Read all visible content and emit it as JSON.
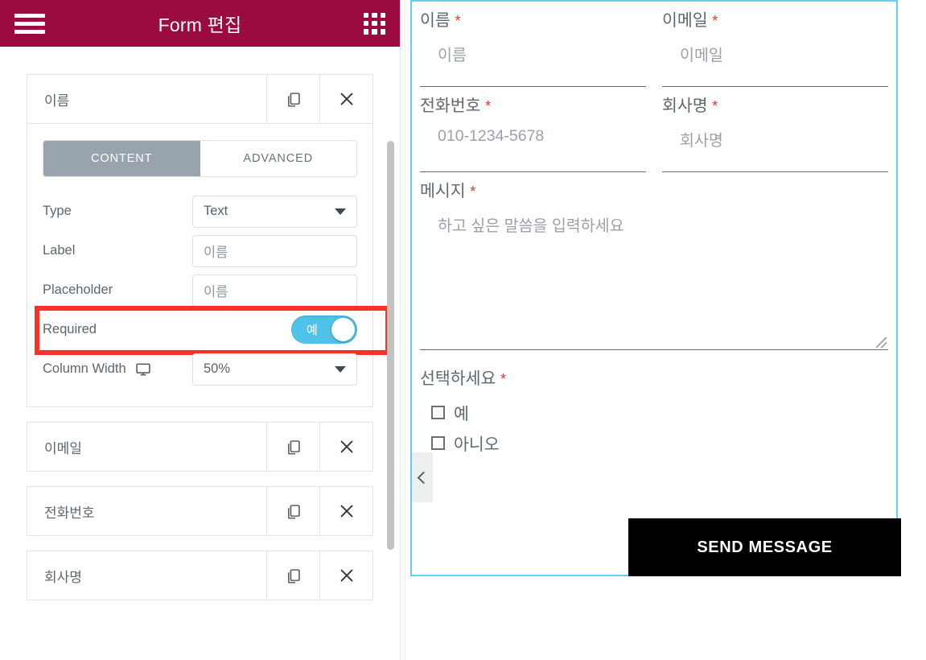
{
  "editor": {
    "header": {
      "title": "Form 편집",
      "menu_icon": "hamburger-icon",
      "apps_icon": "apps-grid-icon"
    },
    "selected_field": {
      "name": "이름",
      "duplicate_icon": "copy-icon",
      "delete_icon": "close-icon",
      "tabs": [
        {
          "label": "CONTENT",
          "active": true
        },
        {
          "label": "ADVANCED",
          "active": false
        }
      ],
      "properties": [
        {
          "label": "Type",
          "control": "select",
          "value": "Text"
        },
        {
          "label": "Label",
          "control": "input",
          "value": "이름"
        },
        {
          "label": "Placeholder",
          "control": "input",
          "value": "이름"
        },
        {
          "label": "Required",
          "control": "toggle",
          "value": "예",
          "on": true,
          "highlighted": true
        },
        {
          "label": "Column Width",
          "control": "select",
          "value": "50%",
          "device_icon": "monitor-icon"
        }
      ]
    },
    "other_fields": [
      {
        "name": "이메일"
      },
      {
        "name": "전화번호"
      },
      {
        "name": "회사명"
      }
    ],
    "colors": {
      "header_bg": "#9b0b41",
      "tab_active_bg": "#98a3ad",
      "toggle_on": "#4fc2e9",
      "highlight_border": "#f8302a"
    }
  },
  "preview": {
    "border_color": "#67ccf5",
    "required_marker": "*",
    "fields": [
      {
        "label": "이름",
        "required": true,
        "placeholder": "이름",
        "type": "text"
      },
      {
        "label": "이메일",
        "required": true,
        "placeholder": "이메일",
        "type": "text"
      },
      {
        "label": "전화번호",
        "required": true,
        "placeholder": "010-1234-5678",
        "type": "text"
      },
      {
        "label": "회사명",
        "required": true,
        "placeholder": "회사명",
        "type": "text"
      },
      {
        "label": "메시지",
        "required": true,
        "placeholder": "하고 싶은 말씀을 입력하세요",
        "type": "textarea"
      }
    ],
    "choice_group": {
      "label": "선택하세요",
      "required": true,
      "options": [
        "예",
        "아니오"
      ]
    },
    "submit_label": "SEND MESSAGE",
    "collapse_handle_icon": "chevron-left-icon"
  }
}
